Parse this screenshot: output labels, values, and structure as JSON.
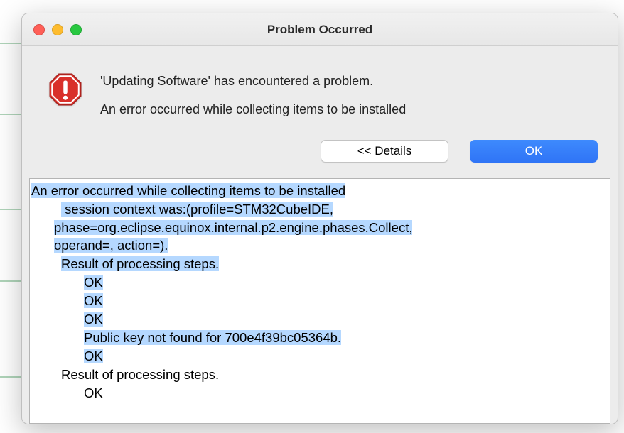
{
  "dialog": {
    "title": "Problem Occurred",
    "heading": "'Updating Software' has encountered a problem.",
    "subheading": "An error occurred while collecting items to be installed",
    "details_button": "<< Details",
    "ok_button": "OK"
  },
  "details": {
    "l0": "An error occurred while collecting items to be installed",
    "l1a": " session context was:(profile=STM32CubeIDE,",
    "l1b": "phase=org.eclipse.equinox.internal.p2.engine.phases.Collect,",
    "l1c": "operand=, action=).",
    "l2": "Result of processing steps.",
    "l3a": "OK",
    "l3b": "OK",
    "l3c": "OK",
    "l4": "Public key not found for 700e4f39bc05364b.",
    "l5": "OK",
    "l6": "Result of processing steps.",
    "l7": "OK"
  }
}
